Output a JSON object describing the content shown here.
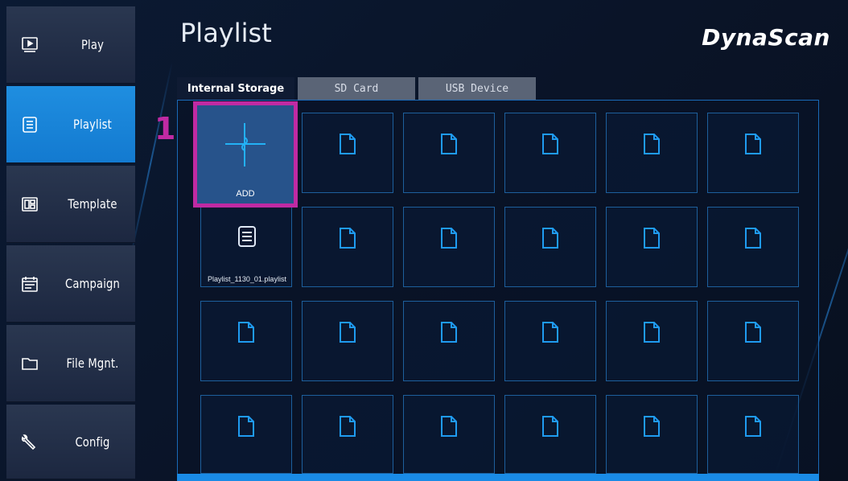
{
  "sidebar": {
    "items": [
      {
        "label": "Play",
        "icon": "play-icon"
      },
      {
        "label": "Playlist",
        "icon": "playlist-icon",
        "active": true
      },
      {
        "label": "Template",
        "icon": "template-icon"
      },
      {
        "label": "Campaign",
        "icon": "campaign-icon"
      },
      {
        "label": "File Mgnt.",
        "icon": "folder-icon"
      },
      {
        "label": "Config",
        "icon": "wrench-icon"
      }
    ]
  },
  "header": {
    "title": "Playlist",
    "brand": "DynaScan"
  },
  "tabs": [
    {
      "label": "Internal Storage",
      "active": true
    },
    {
      "label": "SD Card"
    },
    {
      "label": "USB Device"
    }
  ],
  "grid": {
    "add_label": "ADD",
    "marker": "1",
    "playlist_item": "Playlist_1130_01.playlist"
  },
  "colors": {
    "accent": "#1a8be6",
    "highlight": "#c02aa3",
    "sidebar_active": "#1f8ee0"
  }
}
